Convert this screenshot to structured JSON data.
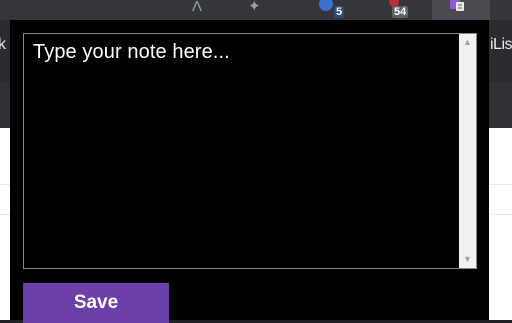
{
  "toolbar": {
    "icons": [
      "profile-icon",
      "reading-list-icon",
      "extension-icon",
      "extension-icon",
      "notes-extension-icon"
    ],
    "badges": {
      "ext1": "5",
      "ext2": "54"
    }
  },
  "bookmarks": {
    "left_fragment": "k",
    "right_fragment": "iLis"
  },
  "popup": {
    "note_placeholder": "Type your note here...",
    "save_label": "Save",
    "colors": {
      "background": "#000000",
      "button": "#6b3fa8",
      "text": "#ffffff"
    }
  }
}
